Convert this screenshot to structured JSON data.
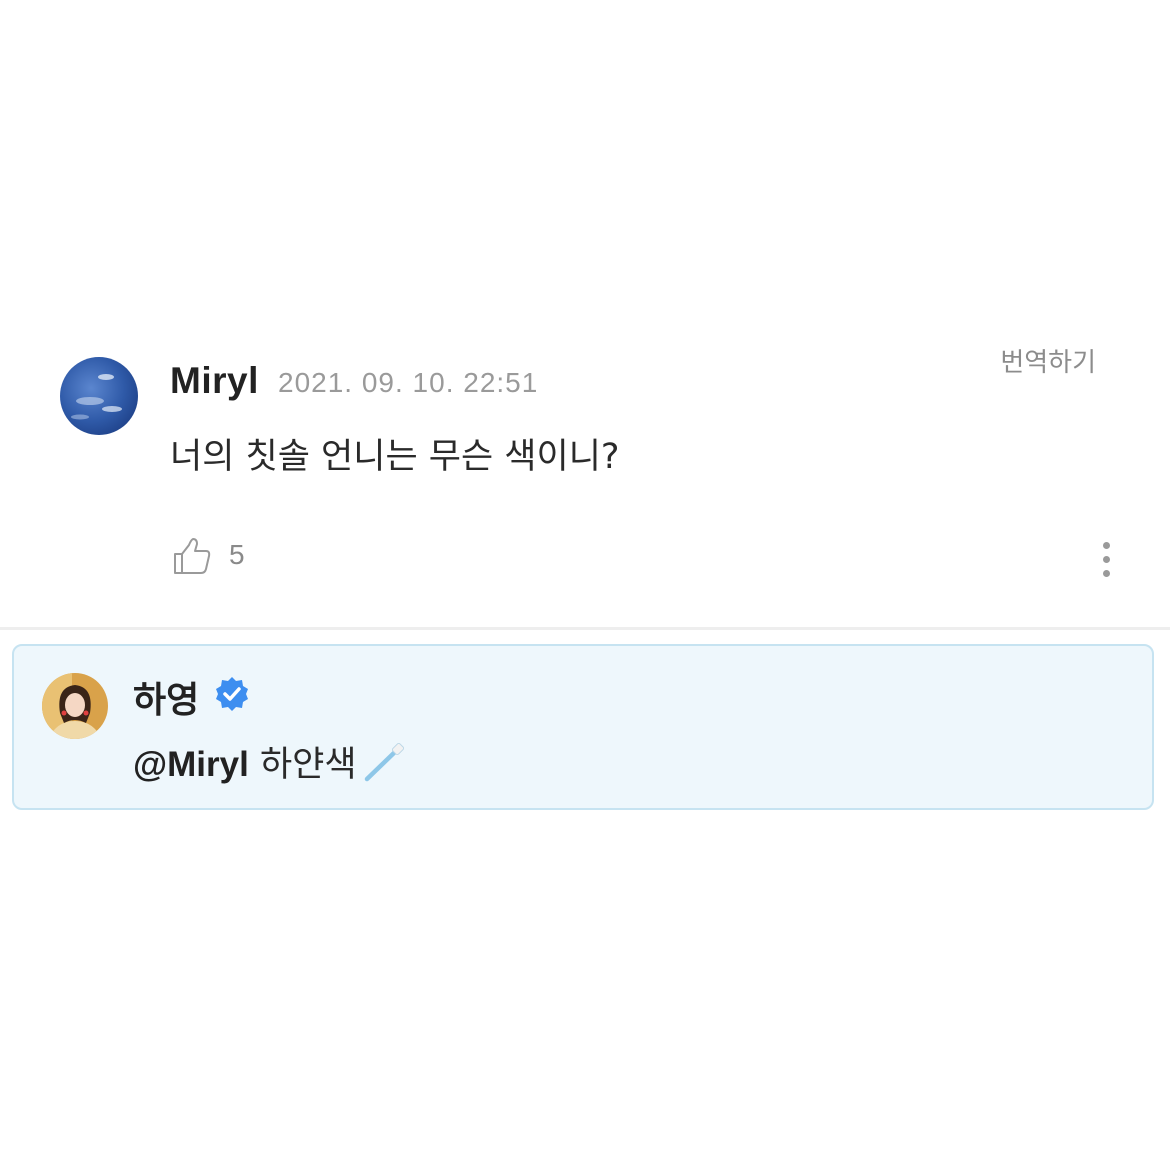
{
  "comment": {
    "author": "Miryl",
    "timestamp": "2021. 09. 10. 22:51",
    "translate_label": "번역하기",
    "text": "너의 칫솔 언니는 무슨 색이니?",
    "like_count": "5",
    "avatar_icon": "sky-avatar",
    "like_icon": "thumbs-up-icon",
    "more_icon": "more-vertical-icon"
  },
  "reply": {
    "author": "하영",
    "verified_icon": "verified-badge-icon",
    "mention": "@Miryl",
    "text": "하얀색",
    "emoji_icon": "toothbrush-icon",
    "colors": {
      "background": "#eef7fc",
      "border": "#c6e3f1",
      "verified": "#3d8ef0"
    }
  }
}
